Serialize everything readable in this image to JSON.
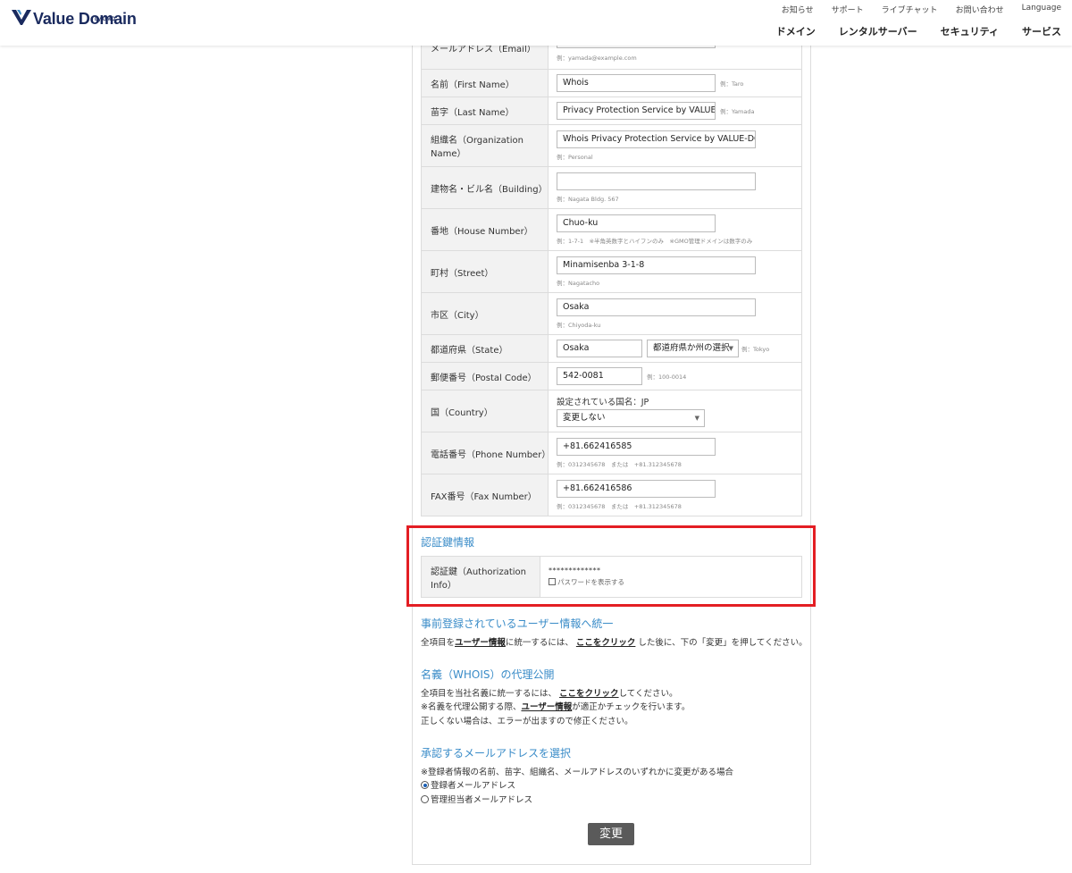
{
  "header": {
    "logo_text": "Value Domain",
    "logo_sub": "by GMO",
    "util_nav": [
      "お知らせ",
      "サポート",
      "ライブチャット",
      "お問い合わせ",
      "Language"
    ],
    "main_nav": [
      "ドメイン",
      "レンタルサーバー",
      "セキュリティ",
      "サービス"
    ]
  },
  "form": {
    "email": {
      "label": "メールアドレス（Email）",
      "example": "例：yamada@example.com"
    },
    "first_name": {
      "label": "名前（First Name）",
      "value": "Whois",
      "example": "例：Taro"
    },
    "last_name": {
      "label": "苗字（Last Name）",
      "value": "Privacy Protection Service by VALUE-DO",
      "example": "例：Yamada"
    },
    "organization": {
      "label": "組織名（Organization Name）",
      "value": "Whois Privacy Protection Service by VALUE-DOMAIN",
      "example": "例：Personal"
    },
    "building": {
      "label": "建物名・ビル名（Building）",
      "value": "",
      "example": "例：Nagata Bldg. 567"
    },
    "house_number": {
      "label": "番地（House Number）",
      "value": "Chuo-ku",
      "example": "例：1-7-1　※半角英数字とハイフンのみ　※GMO管理ドメインは数字のみ"
    },
    "street": {
      "label": "町村（Street）",
      "value": "Minamisenba 3-1-8",
      "example": "例：Nagatacho"
    },
    "city": {
      "label": "市区（City）",
      "value": "Osaka",
      "example": "例：Chiyoda-ku"
    },
    "state": {
      "label": "都道府県（State）",
      "value": "Osaka",
      "select": "都道府県か州の選択",
      "example": "例：Tokyo"
    },
    "postal": {
      "label": "郵便番号（Postal Code）",
      "value": "542-0081",
      "example": "例：100-0014"
    },
    "country": {
      "label": "国（Country）",
      "current": "設定されている国名：JP",
      "select": "変更しない"
    },
    "phone": {
      "label": "電話番号（Phone Number）",
      "value": "+81.662416585",
      "example": "例：0312345678　または　+81.312345678"
    },
    "fax": {
      "label": "FAX番号（Fax Number）",
      "value": "+81.662416586",
      "example": "例：0312345678　または　+81.312345678"
    }
  },
  "auth": {
    "section_title": "認証鍵情報",
    "label": "認証鍵（Authorization Info）",
    "value": "*************",
    "show_password": "パスワードを表示する"
  },
  "unify": {
    "title": "事前登録されているユーザー情報へ統一",
    "line_pre": "全項目を",
    "link1": "ユーザー情報",
    "line_mid": "に統一するには、",
    "link2": "ここをクリック",
    "line_post": "した後に、下の「変更」を押してください。"
  },
  "whois_proxy": {
    "title": "名義（WHOIS）の代理公開",
    "line1_pre": "全項目を当社名義に統一するには、",
    "line1_link": "ここをクリック",
    "line1_post": "してください。",
    "line2_pre": "※名義を代理公開する際、",
    "line2_link": "ユーザー情報",
    "line2_post": "が適正かチェックを行います。",
    "line3": "正しくない場合は、エラーが出ますので修正ください。"
  },
  "approval": {
    "title": "承認するメールアドレスを選択",
    "note": "※登録者情報の名前、苗字、組織名、メールアドレスのいずれかに変更がある場合",
    "option1": "登録者メールアドレス",
    "option2": "管理担当者メールアドレス"
  },
  "submit_label": "変更"
}
